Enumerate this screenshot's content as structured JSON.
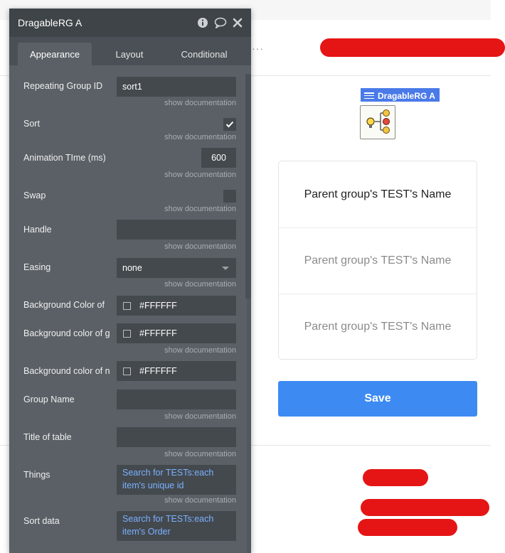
{
  "panel": {
    "title": "DragableRG A",
    "icons": [
      "info-icon",
      "comment-icon",
      "close-icon"
    ],
    "tabs": [
      "Appearance",
      "Layout",
      "Conditional"
    ],
    "active_tab": "Appearance",
    "doc_label": "show documentation",
    "props": {
      "repeating_group_id": {
        "label": "Repeating Group ID",
        "value": "sort1"
      },
      "sort": {
        "label": "Sort",
        "checked": true
      },
      "animation_time": {
        "label": "Animation TIme (ms)",
        "value": "600"
      },
      "swap": {
        "label": "Swap",
        "checked": false
      },
      "handle": {
        "label": "Handle",
        "value": ""
      },
      "easing": {
        "label": "Easing",
        "value": "none"
      },
      "bg_color_1": {
        "label": "Background Color of",
        "value": "#FFFFFF"
      },
      "bg_color_2": {
        "label": "Background color of g",
        "value": "#FFFFFF"
      },
      "bg_color_3": {
        "label": "Background color of n",
        "value": "#FFFFFF"
      },
      "group_name": {
        "label": "Group Name",
        "value": ""
      },
      "title_of_table": {
        "label": "Title of table",
        "value": ""
      },
      "things": {
        "label": "Things",
        "value_line1": "Search for TESTs:each",
        "value_line2": "item's unique id"
      },
      "sort_data": {
        "label": "Sort data",
        "value_line1": "Search for TESTs:each",
        "value_line2": "item's Order"
      }
    }
  },
  "canvas": {
    "more_label": "···",
    "element_tag": "DragableRG A",
    "rg_cells": [
      "Parent group's TEST's Name",
      "Parent group's TEST's Name",
      "Parent group's TEST's Name"
    ],
    "save_label": "Save"
  },
  "colors": {
    "panel_bg": "#5a6066",
    "panel_header": "#3e4448",
    "input_bg": "#44494e",
    "dynamic_text": "#7ab1ff",
    "save_button": "#3d8bf2",
    "element_tag": "#4a7ae8",
    "redaction": "#e51515"
  }
}
